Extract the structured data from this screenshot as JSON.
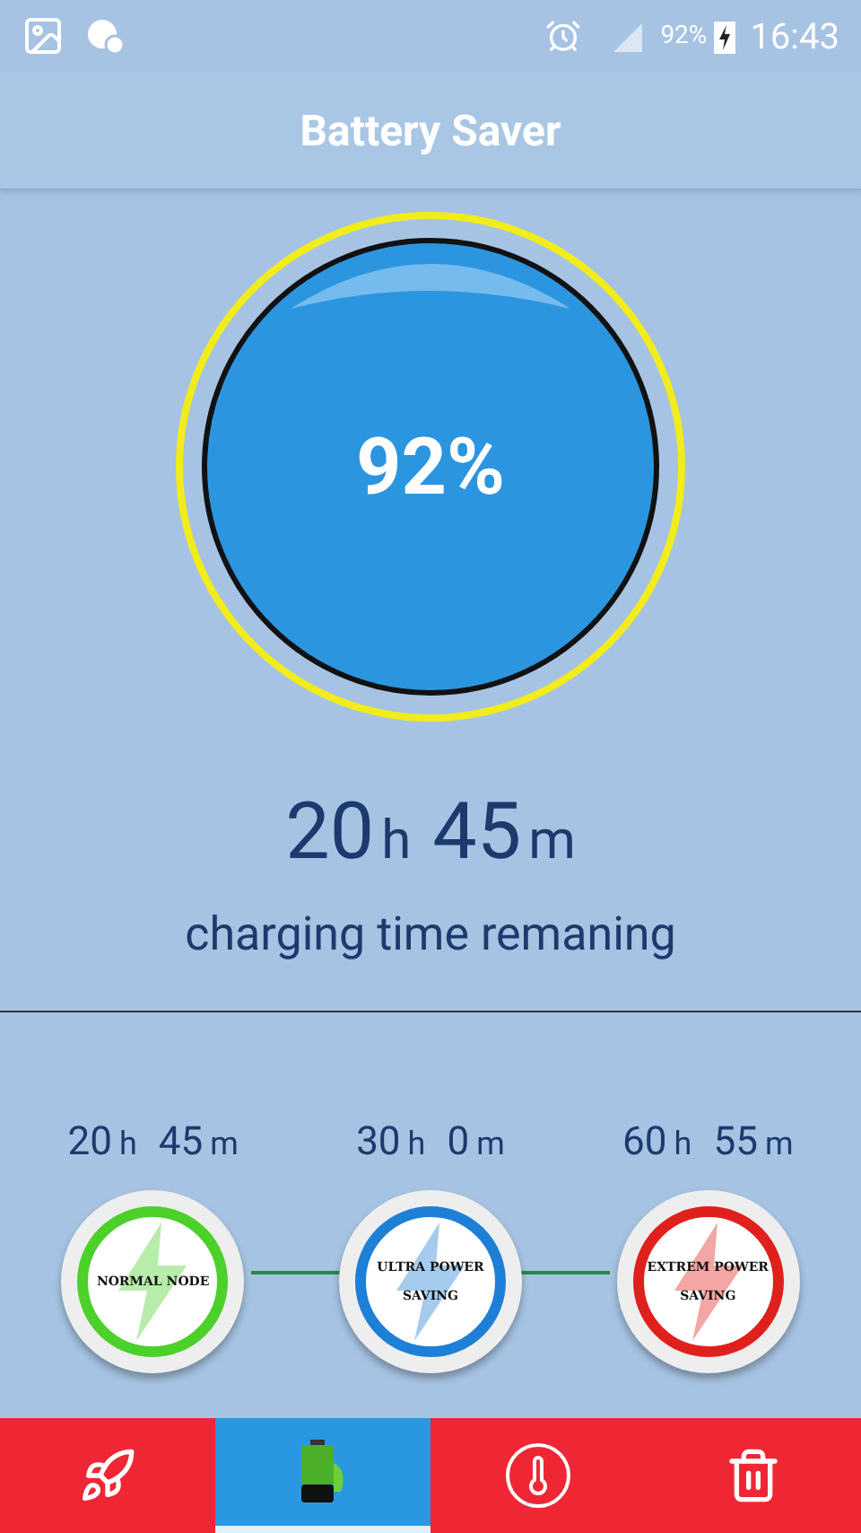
{
  "status_bar": {
    "battery": "92%",
    "time": "16:43"
  },
  "title": "Battery Saver",
  "gauge": {
    "percent": "92%"
  },
  "remaining": {
    "parts": [
      {
        "value": "20",
        "unit": "h"
      },
      {
        "value": "45",
        "unit": "m"
      }
    ],
    "caption": "charging time remaning"
  },
  "modes": [
    {
      "parts": [
        {
          "value": "20",
          "unit": "h"
        },
        {
          "value": "45",
          "unit": "m"
        }
      ],
      "label": "NORMAL NODE",
      "color": "#4cd02a"
    },
    {
      "parts": [
        {
          "value": "30",
          "unit": "h"
        },
        {
          "value": "0",
          "unit": "m"
        }
      ],
      "label": "ULTRA POWER",
      "sublabel": "SAVING",
      "color": "#1e7fd6"
    },
    {
      "parts": [
        {
          "value": "60",
          "unit": "h"
        },
        {
          "value": "55",
          "unit": "m"
        }
      ],
      "label": "EXTREM POWER",
      "sublabel": "SAVING",
      "color": "#e0201c"
    }
  ],
  "nav": [
    {
      "kind": "rocket",
      "selected": false
    },
    {
      "kind": "battery",
      "selected": true
    },
    {
      "kind": "temperature",
      "selected": false
    },
    {
      "kind": "trash",
      "selected": false
    }
  ]
}
